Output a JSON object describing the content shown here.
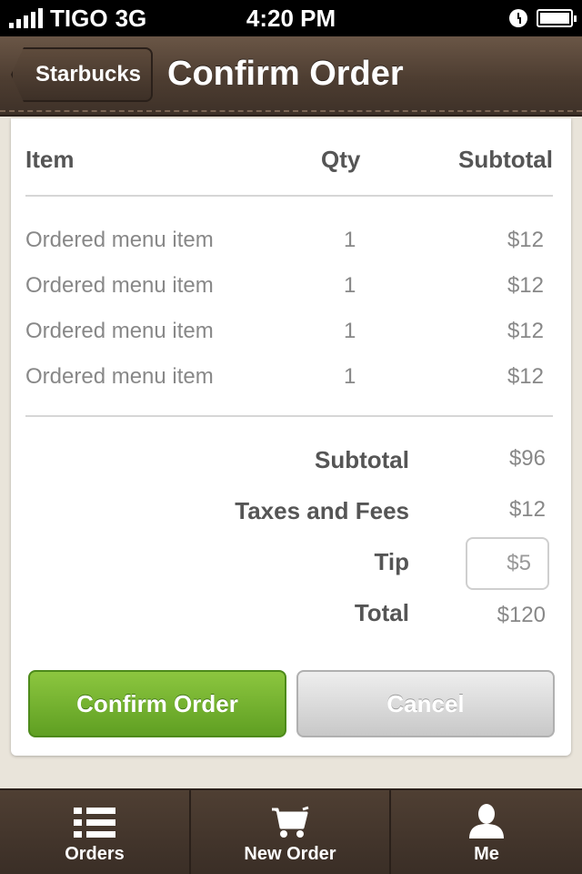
{
  "status_bar": {
    "carrier": "TIGO",
    "network": "3G",
    "time": "4:20 PM"
  },
  "nav": {
    "back_label": "Starbucks",
    "title": "Confirm Order"
  },
  "order_table": {
    "headers": {
      "item": "Item",
      "qty": "Qty",
      "subtotal": "Subtotal"
    },
    "rows": [
      {
        "item": "Ordered menu item",
        "qty": "1",
        "subtotal": "$12"
      },
      {
        "item": "Ordered menu item",
        "qty": "1",
        "subtotal": "$12"
      },
      {
        "item": "Ordered menu item",
        "qty": "1",
        "subtotal": "$12"
      },
      {
        "item": "Ordered menu item",
        "qty": "1",
        "subtotal": "$12"
      }
    ]
  },
  "summary": {
    "subtotal_label": "Subtotal",
    "subtotal_value": "$96",
    "taxes_label": "Taxes and Fees",
    "taxes_value": "$12",
    "tip_label": "Tip",
    "tip_value": "$5",
    "total_label": "Total",
    "total_value": "$120"
  },
  "actions": {
    "confirm_label": "Confirm Order",
    "cancel_label": "Cancel"
  },
  "tabs": [
    {
      "label": "Orders",
      "icon": "list-icon"
    },
    {
      "label": "New Order",
      "icon": "cart-icon"
    },
    {
      "label": "Me",
      "icon": "person-icon"
    }
  ],
  "colors": {
    "confirm_green": "#6fb02c",
    "nav_brown": "#4d3d31"
  }
}
